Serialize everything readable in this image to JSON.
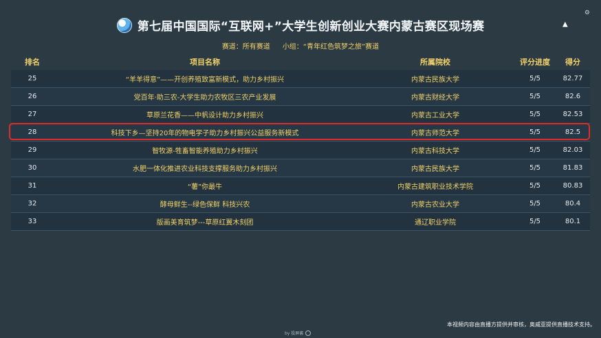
{
  "header": {
    "title": "第七届中国国际“互联网+”大学生创新创业大赛内蒙古赛区现场赛",
    "track_label": "赛道：所有赛道",
    "group_label": "小组：“青年红色筑梦之旅”赛道"
  },
  "table": {
    "columns": [
      "排名",
      "项目名称",
      "所属院校",
      "评分进度",
      "得分"
    ],
    "rows": [
      {
        "rank": "25",
        "name": "“羊羊得意”——开创养殖致富新模式，助力乡村振兴",
        "school": "内蒙古民族大学",
        "progress": "5/5",
        "score": "82.77"
      },
      {
        "rank": "26",
        "name": "党百年·助三农-大学生助力农牧区三农产业发展",
        "school": "内蒙古财经大学",
        "progress": "5/5",
        "score": "82.6"
      },
      {
        "rank": "27",
        "name": "草原兰花香——中帆设计助力乡村振兴",
        "school": "内蒙古工业大学",
        "progress": "5/5",
        "score": "82.53"
      },
      {
        "rank": "28",
        "name": "科技下乡—坚持20年的物电学子助力乡村振兴公益服务新模式",
        "school": "内蒙古师范大学",
        "progress": "5/5",
        "score": "82.5"
      },
      {
        "rank": "29",
        "name": "智牧源-牲畜智能养殖助力乡村振兴",
        "school": "内蒙古科技大学",
        "progress": "5/5",
        "score": "82.03"
      },
      {
        "rank": "30",
        "name": "水肥一体化推进农业科技支撑服务助力乡村振兴",
        "school": "内蒙古民族大学",
        "progress": "5/5",
        "score": "81.83"
      },
      {
        "rank": "31",
        "name": "“薯”你最牛",
        "school": "内蒙古建筑职业技术学院",
        "progress": "5/5",
        "score": "80.83"
      },
      {
        "rank": "32",
        "name": "酵母鲜生--绿色保鲜 科技兴农",
        "school": "内蒙古农业大学",
        "progress": "5/5",
        "score": "80.4"
      },
      {
        "rank": "33",
        "name": "版画美育筑梦---草原红翼木刻团",
        "school": "通辽职业学院",
        "progress": "5/5",
        "score": "80.1"
      }
    ]
  },
  "footer": {
    "note": "本视频内容由直播方提供并审核，奥威亚提供直播技术支持。",
    "watermark": "by 投屏酱"
  },
  "icons": {
    "logo": "globe-logo-icon",
    "corner": "settings-icon",
    "cursor": "cursor-icon"
  },
  "colors": {
    "background": "#2c3a44",
    "accent_yellow": "#f2d26a",
    "highlight_red": "#e22a2a"
  }
}
